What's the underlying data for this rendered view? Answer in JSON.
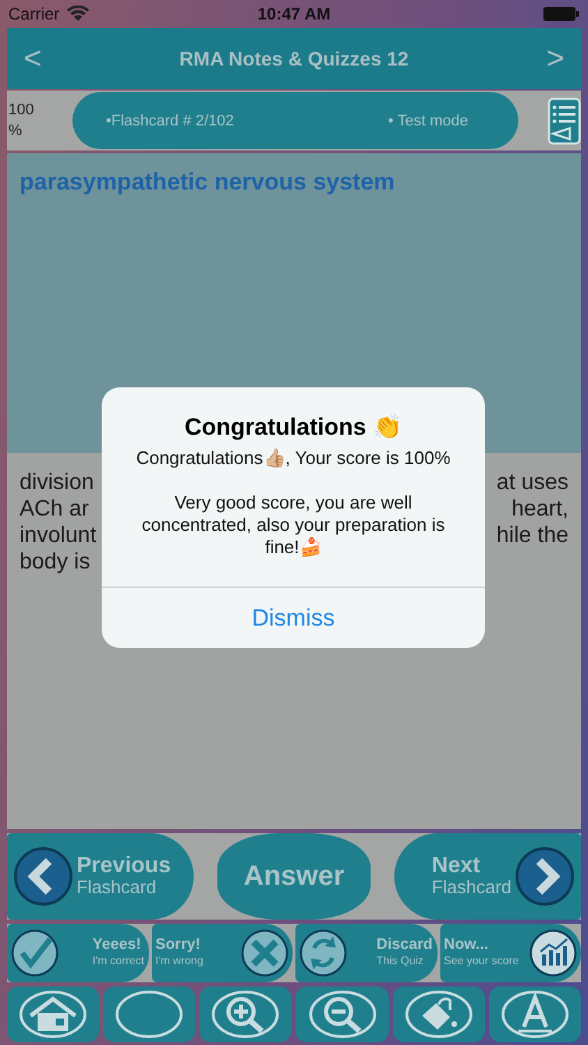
{
  "status_bar": {
    "carrier": "Carrier",
    "time": "10:47 AM"
  },
  "nav_bar": {
    "back": "<",
    "title": "RMA Notes & Quizzes 12",
    "forward": ">"
  },
  "info_bar": {
    "score": "100 %",
    "flashcard": "•Flashcard #  2/102",
    "mode": "• Test mode"
  },
  "card": {
    "title": "parasympathetic nervous system",
    "lines": [
      {
        "left": "division",
        "right": "at uses"
      },
      {
        "left": "ACh ar",
        "right": "heart,"
      },
      {
        "left": "involunt",
        "right": "hile the"
      },
      {
        "left": "body is"
      }
    ]
  },
  "alert": {
    "title": "Congratulations 👏",
    "score_line": "Congratulations👍🏼, Your score is 100%",
    "message": "Very good score, you are well concentrated, also your preparation is fine!🍰",
    "button": "Dismiss"
  },
  "actions": [
    {
      "kind": "previous",
      "title": "Previous",
      "subtitle": "Flashcard"
    },
    {
      "kind": "answer",
      "title": "Answer"
    },
    {
      "kind": "next",
      "title": "Next",
      "subtitle": "Flashcard"
    }
  ],
  "grading": [
    {
      "kind": "correct",
      "title": "Yeees!",
      "subtitle": "I'm correct"
    },
    {
      "kind": "wrong",
      "title": "Sorry!",
      "subtitle": "I'm wrong"
    },
    {
      "kind": "discard",
      "title": "Discard",
      "subtitle": "This Quiz"
    },
    {
      "kind": "score",
      "title": "Now...",
      "subtitle": "See your score"
    }
  ],
  "tools": [
    {
      "kind": "home"
    },
    {
      "kind": "blank"
    },
    {
      "kind": "zoom-in"
    },
    {
      "kind": "zoom-out"
    },
    {
      "kind": "clear"
    },
    {
      "kind": "font"
    }
  ]
}
